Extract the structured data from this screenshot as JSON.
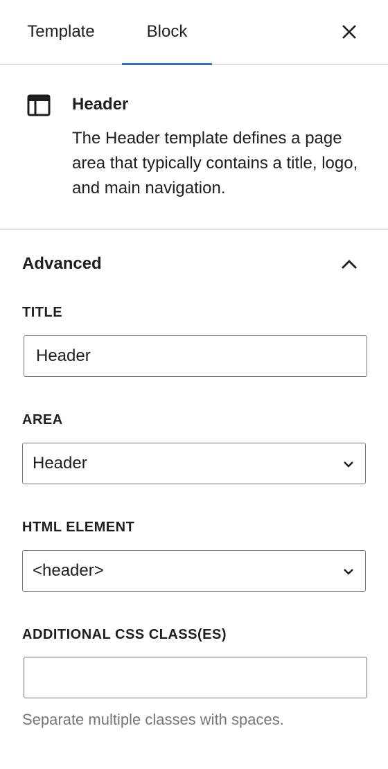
{
  "tabs": {
    "template_label": "Template",
    "block_label": "Block",
    "active": "Block",
    "active_color": "#3873b0"
  },
  "close": {
    "icon": "close-icon"
  },
  "block_card": {
    "icon": "header-layout-icon",
    "title": "Header",
    "description": "The Header template defines a page area that typically contains a title, logo, and main navigation."
  },
  "advanced": {
    "title": "Advanced",
    "expanded": true,
    "fields": {
      "title_label": "TITLE",
      "title_value": "Header",
      "area_label": "AREA",
      "area_value": "Header",
      "html_element_label": "HTML ELEMENT",
      "html_element_value": "<header>",
      "css_class_label": "ADDITIONAL CSS CLASS(ES)",
      "css_class_value": "",
      "css_class_help": "Separate multiple classes with spaces."
    }
  }
}
